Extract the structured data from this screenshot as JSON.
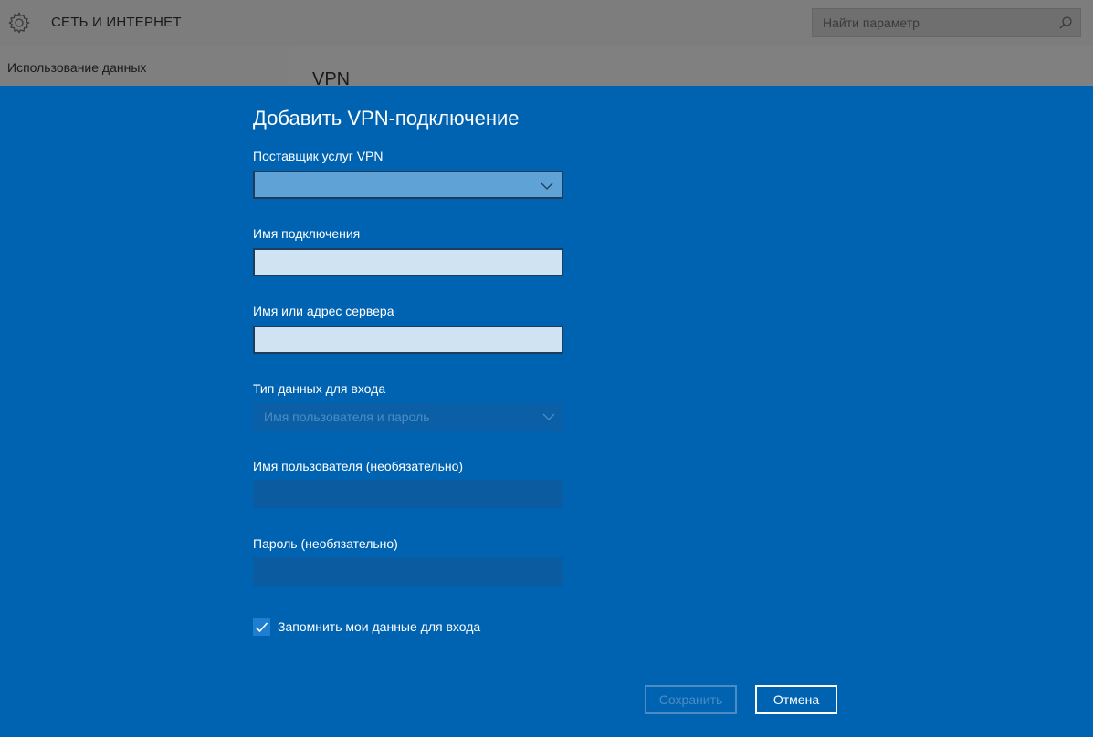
{
  "app": {
    "title": "СЕТЬ И ИНТЕРНЕТ",
    "icon": "gear-icon",
    "search": {
      "placeholder": "Найти параметр",
      "icon": "search-icon"
    }
  },
  "sidebar": {
    "items": [
      {
        "label": "Использование данных"
      }
    ]
  },
  "main": {
    "heading": "VPN"
  },
  "dialog": {
    "title": "Добавить VPN-подключение",
    "accent_color": "#0063b1",
    "fields": {
      "provider": {
        "label": "Поставщик услуг VPN",
        "value": ""
      },
      "connection_name": {
        "label": "Имя подключения",
        "value": ""
      },
      "server": {
        "label": "Имя или адрес сервера",
        "value": ""
      },
      "signin_type": {
        "label": "Тип данных для входа",
        "value": "Имя пользователя и пароль"
      },
      "username": {
        "label": "Имя пользователя (необязательно)",
        "value": ""
      },
      "password": {
        "label": "Пароль (необязательно)",
        "value": ""
      }
    },
    "remember": {
      "label": "Запомнить мои данные для входа",
      "checked": true
    },
    "buttons": {
      "save": "Сохранить",
      "cancel": "Отмена"
    }
  }
}
